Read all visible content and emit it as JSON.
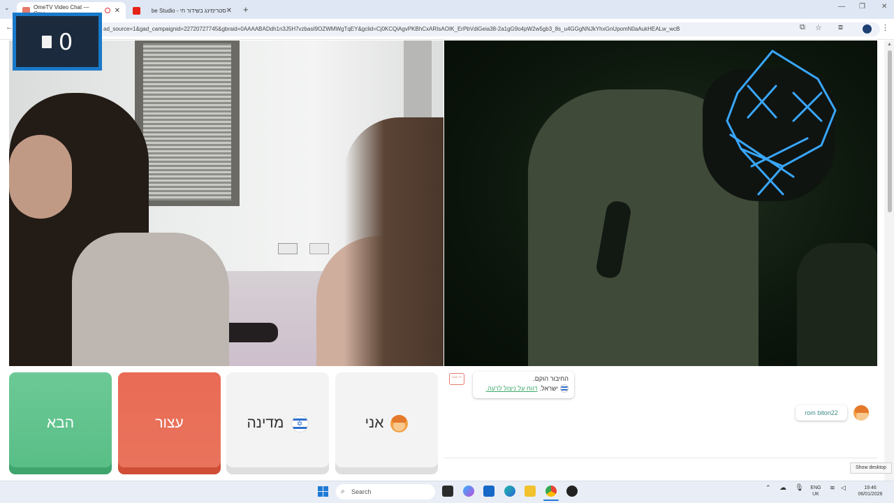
{
  "browser": {
    "tabs": [
      {
        "title": "OmeTV Video Chat — Ome",
        "active": true
      },
      {
        "title": "סטרימינג בשידור חי - be Studio",
        "active": false
      }
    ],
    "new_tab": "+",
    "address": "ad_source=1&gad_campaignid=22720727745&gbraid=0AAAABADdh1n3J5H7vzbasI9OZWMWgTqEY&gclid=Cj0KCQiAgvPKBhCxARIsAOIK_ErPbVdiGeia38-2a1gG9o4pW2w5gb3_8s_u4GGgNNJkYhxGnUpomN0aAukHEALw_wcB",
    "window_controls": {
      "minimize": "—",
      "restore": "❐",
      "close": "✕"
    }
  },
  "score": {
    "value": "0"
  },
  "buttons": {
    "next": "הבא",
    "stop": "עצור",
    "country": "מדינה",
    "me": "אני"
  },
  "chat": {
    "logo": "Ome TV",
    "system_line1": "החיבור הוקם.",
    "system_country": "ישראל.",
    "system_report": "דווח על ניצול לרעה.",
    "user_message": "rom biton22"
  },
  "tooltip": "Show desktop",
  "taskbar": {
    "search_placeholder": "Search",
    "lang_top": "ENG",
    "lang_bottom": "UK",
    "time": "19:46",
    "date": "06/01/2026"
  },
  "colors": {
    "next": "#5fc28c",
    "stop": "#e86e57",
    "score_border": "#1a79c9",
    "link": "#3ea96b"
  }
}
